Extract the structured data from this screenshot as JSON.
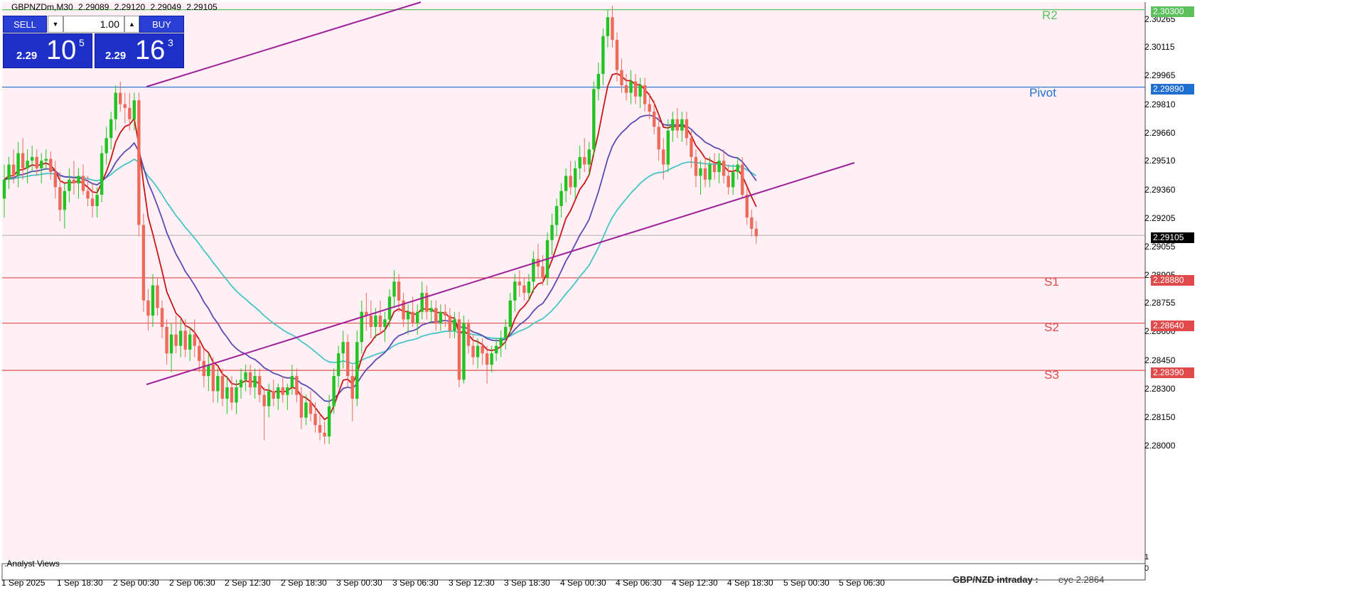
{
  "header": {
    "symbol": "GBPNZDm,M30",
    "ohlc": [
      "2.29089",
      "2.29120",
      "2.29049",
      "2.29105"
    ]
  },
  "trade_panel": {
    "sell_label": "SELL",
    "buy_label": "BUY",
    "lot": "1.00",
    "sell_price": {
      "small": "2.29",
      "big": "10",
      "sup": "5"
    },
    "buy_price": {
      "small": "2.29",
      "big": "16",
      "sup": "3"
    }
  },
  "price_axis": [
    "2.30265",
    "2.30115",
    "2.29965",
    "2.29810",
    "2.29660",
    "2.29510",
    "2.29360",
    "2.29205",
    "2.29055",
    "2.28905",
    "2.28755",
    "2.28600",
    "2.28450",
    "2.28300",
    "2.28150",
    "2.28000"
  ],
  "levels": [
    {
      "name": "R2",
      "value": "2.30300",
      "color": "#5cc05c"
    },
    {
      "name": "Pivot",
      "value": "2.29890",
      "color": "#1f6fd0"
    },
    {
      "name": "S1",
      "value": "2.28880",
      "color": "#e04a4a"
    },
    {
      "name": "S2",
      "value": "2.28640",
      "color": "#e04a4a"
    },
    {
      "name": "S3",
      "value": "2.28390",
      "color": "#e04a4a"
    }
  ],
  "current_price": "2.29105",
  "time_axis": [
    "1 Sep 2025",
    "1 Sep 18:30",
    "2 Sep 00:30",
    "2 Sep 06:30",
    "2 Sep 12:30",
    "2 Sep 18:30",
    "3 Sep 00:30",
    "3 Sep 06:30",
    "3 Sep 12:30",
    "3 Sep 18:30",
    "4 Sep 00:30",
    "4 Sep 06:30",
    "4 Sep 12:30",
    "4 Sep 18:30",
    "5 Sep 00:30",
    "5 Sep 06:30"
  ],
  "subwindow": {
    "label": ".Analyst Views",
    "axis_top": "1",
    "axis_bottom": "0"
  },
  "caption": {
    "title": "GBP/NZD intraday :",
    "value": "eye 2.2864"
  },
  "colors": {
    "background": "#fff0f5",
    "bull": "#22c322",
    "bear": "#ee6a5a",
    "ma_fast": "#c81414",
    "ma_mid": "#5a4ab4",
    "ma_slow": "#48c4c4",
    "trendline": "#a0209a"
  },
  "chart_data": {
    "type": "candlestick",
    "ylim": [
      2.2792,
      2.3034
    ],
    "series": [
      {
        "name": "GBPNZDm,M30",
        "values": [
          [
            2.293,
            2.2948,
            2.292,
            2.294
          ],
          [
            2.294,
            2.2952,
            2.2935,
            2.2948
          ],
          [
            2.2948,
            2.2956,
            2.2938,
            2.2942
          ],
          [
            2.2942,
            2.296,
            2.2936,
            2.2954
          ],
          [
            2.2954,
            2.2962,
            2.294,
            2.2946
          ],
          [
            2.2946,
            2.2956,
            2.2938,
            2.295
          ],
          [
            2.295,
            2.2958,
            2.2944,
            2.2952
          ],
          [
            2.2952,
            2.2956,
            2.2942,
            2.2946
          ],
          [
            2.2946,
            2.2954,
            2.2938,
            2.295
          ],
          [
            2.295,
            2.2956,
            2.2945,
            2.2951
          ],
          [
            2.2951,
            2.2955,
            2.294,
            2.2944
          ],
          [
            2.2944,
            2.295,
            2.293,
            2.2936
          ],
          [
            2.2936,
            2.2944,
            2.2918,
            2.2924
          ],
          [
            2.2924,
            2.2938,
            2.2914,
            2.2934
          ],
          [
            2.2934,
            2.2946,
            2.2928,
            2.294
          ],
          [
            2.294,
            2.295,
            2.2932,
            2.2938
          ],
          [
            2.2938,
            2.2946,
            2.293,
            2.2942
          ],
          [
            2.2942,
            2.2948,
            2.2932,
            2.2934
          ],
          [
            2.2934,
            2.2942,
            2.2926,
            2.293
          ],
          [
            2.293,
            2.2938,
            2.292,
            2.2926
          ],
          [
            2.2926,
            2.2936,
            2.292,
            2.2932
          ],
          [
            2.2932,
            2.2958,
            2.2928,
            2.2954
          ],
          [
            2.2954,
            2.2968,
            2.2948,
            2.2962
          ],
          [
            2.2962,
            2.2976,
            2.2956,
            2.2972
          ],
          [
            2.2972,
            2.299,
            2.2966,
            2.2986
          ],
          [
            2.2986,
            2.2992,
            2.2976,
            2.298
          ],
          [
            2.298,
            2.2986,
            2.297,
            2.2978
          ],
          [
            2.2978,
            2.2986,
            2.2966,
            2.2972
          ],
          [
            2.2972,
            2.2986,
            2.2966,
            2.2982
          ],
          [
            2.2982,
            2.2986,
            2.291,
            2.2916
          ],
          [
            2.2916,
            2.2922,
            2.287,
            2.2876
          ],
          [
            2.2876,
            2.2882,
            2.286,
            2.2868
          ],
          [
            2.2868,
            2.289,
            2.2862,
            2.2884
          ],
          [
            2.2884,
            2.2888,
            2.2868,
            2.2872
          ],
          [
            2.2872,
            2.2876,
            2.2856,
            2.2862
          ],
          [
            2.2862,
            2.2866,
            2.2842,
            2.2848
          ],
          [
            2.2848,
            2.2864,
            2.2838,
            2.2858
          ],
          [
            2.2858,
            2.2868,
            2.2848,
            2.2852
          ],
          [
            2.2852,
            2.2866,
            2.2846,
            2.286
          ],
          [
            2.286,
            2.2866,
            2.2846,
            2.285
          ],
          [
            2.285,
            2.2862,
            2.2844,
            2.2858
          ],
          [
            2.2858,
            2.2866,
            2.2846,
            2.2852
          ],
          [
            2.2852,
            2.2856,
            2.2838,
            2.2844
          ],
          [
            2.2844,
            2.285,
            2.283,
            2.2836
          ],
          [
            2.2836,
            2.2848,
            2.2828,
            2.2842
          ],
          [
            2.2842,
            2.2846,
            2.2822,
            2.2828
          ],
          [
            2.2828,
            2.284,
            2.2822,
            2.2836
          ],
          [
            2.2836,
            2.284,
            2.282,
            2.2824
          ],
          [
            2.2824,
            2.2836,
            2.2816,
            2.283
          ],
          [
            2.283,
            2.2836,
            2.2818,
            2.2822
          ],
          [
            2.2822,
            2.2834,
            2.2816,
            2.283
          ],
          [
            2.283,
            2.284,
            2.2824,
            2.2834
          ],
          [
            2.2834,
            2.2842,
            2.2828,
            2.2838
          ],
          [
            2.2838,
            2.2842,
            2.2826,
            2.283
          ],
          [
            2.283,
            2.284,
            2.2824,
            2.2836
          ],
          [
            2.2836,
            2.284,
            2.2822,
            2.2826
          ],
          [
            2.2826,
            2.283,
            2.2802,
            2.282
          ],
          [
            2.282,
            2.2832,
            2.2814,
            2.2828
          ],
          [
            2.2828,
            2.2834,
            2.282,
            2.2824
          ],
          [
            2.2824,
            2.2832,
            2.2818,
            2.283
          ],
          [
            2.283,
            2.2836,
            2.2822,
            2.2826
          ],
          [
            2.2826,
            2.2832,
            2.2818,
            2.283
          ],
          [
            2.283,
            2.2842,
            2.2826,
            2.2836
          ],
          [
            2.2836,
            2.284,
            2.2822,
            2.2826
          ],
          [
            2.2826,
            2.283,
            2.2808,
            2.2814
          ],
          [
            2.2814,
            2.2826,
            2.281,
            2.2822
          ],
          [
            2.2822,
            2.2828,
            2.2812,
            2.2816
          ],
          [
            2.2816,
            2.2822,
            2.2806,
            2.281
          ],
          [
            2.281,
            2.2816,
            2.2802,
            2.2806
          ],
          [
            2.2806,
            2.2812,
            2.28,
            2.2804
          ],
          [
            2.2804,
            2.2826,
            2.28,
            2.282
          ],
          [
            2.282,
            2.284,
            2.2816,
            2.2836
          ],
          [
            2.2836,
            2.2852,
            2.283,
            2.2848
          ],
          [
            2.2848,
            2.286,
            2.284,
            2.2854
          ],
          [
            2.2854,
            2.2858,
            2.283,
            2.2836
          ],
          [
            2.2836,
            2.2842,
            2.2812,
            2.2824
          ],
          [
            2.2824,
            2.286,
            2.282,
            2.2854
          ],
          [
            2.2854,
            2.2876,
            2.2848,
            2.287
          ],
          [
            2.287,
            2.288,
            2.286,
            2.2868
          ],
          [
            2.2868,
            2.2876,
            2.2856,
            2.2862
          ],
          [
            2.2862,
            2.2872,
            2.2856,
            2.2868
          ],
          [
            2.2868,
            2.2876,
            2.2858,
            2.2862
          ],
          [
            2.2862,
            2.287,
            2.2854,
            2.2866
          ],
          [
            2.2866,
            2.2882,
            2.2862,
            2.2878
          ],
          [
            2.2878,
            2.2892,
            2.2872,
            2.2886
          ],
          [
            2.2886,
            2.289,
            2.287,
            2.2876
          ],
          [
            2.2876,
            2.288,
            2.2862,
            2.2866
          ],
          [
            2.2866,
            2.2874,
            2.2858,
            2.287
          ],
          [
            2.287,
            2.2878,
            2.2862,
            2.2864
          ],
          [
            2.2864,
            2.2874,
            2.2858,
            2.287
          ],
          [
            2.287,
            2.2886,
            2.2866,
            2.288
          ],
          [
            2.288,
            2.2884,
            2.2866,
            2.287
          ],
          [
            2.287,
            2.2876,
            2.2864,
            2.2872
          ],
          [
            2.2872,
            2.2876,
            2.286,
            2.2864
          ],
          [
            2.2864,
            2.2874,
            2.286,
            2.287
          ],
          [
            2.287,
            2.2874,
            2.2862,
            2.2868
          ],
          [
            2.2868,
            2.2872,
            2.2856,
            2.286
          ],
          [
            2.286,
            2.287,
            2.2856,
            2.2866
          ],
          [
            2.2866,
            2.287,
            2.283,
            2.2834
          ],
          [
            2.2834,
            2.2868,
            2.2832,
            2.2864
          ],
          [
            2.2864,
            2.2866,
            2.2848,
            2.2852
          ],
          [
            2.2852,
            2.2858,
            2.2842,
            2.2846
          ],
          [
            2.2846,
            2.2856,
            2.284,
            2.2852
          ],
          [
            2.2852,
            2.2856,
            2.2842,
            2.2848
          ],
          [
            2.2848,
            2.2852,
            2.2832,
            2.2842
          ],
          [
            2.2842,
            2.2852,
            2.2838,
            2.2848
          ],
          [
            2.2848,
            2.2856,
            2.2844,
            2.2852
          ],
          [
            2.2852,
            2.286,
            2.2846,
            2.2856
          ],
          [
            2.2856,
            2.2866,
            2.285,
            2.2862
          ],
          [
            2.2862,
            2.288,
            2.2858,
            2.2876
          ],
          [
            2.2876,
            2.289,
            2.287,
            2.2886
          ],
          [
            2.2886,
            2.2892,
            2.2878,
            2.2884
          ],
          [
            2.2884,
            2.2888,
            2.2876,
            2.288
          ],
          [
            2.288,
            2.289,
            2.2876,
            2.2886
          ],
          [
            2.2886,
            2.2902,
            2.288,
            2.2898
          ],
          [
            2.2898,
            2.2906,
            2.2888,
            2.2894
          ],
          [
            2.2894,
            2.29,
            2.2884,
            2.2888
          ],
          [
            2.2888,
            2.2912,
            2.2884,
            2.2908
          ],
          [
            2.2908,
            2.2922,
            2.29,
            2.2916
          ],
          [
            2.2916,
            2.293,
            2.291,
            2.2926
          ],
          [
            2.2926,
            2.2938,
            2.292,
            2.2934
          ],
          [
            2.2934,
            2.2946,
            2.2928,
            2.2942
          ],
          [
            2.2942,
            2.295,
            2.2932,
            2.2936
          ],
          [
            2.2936,
            2.295,
            2.293,
            2.2946
          ],
          [
            2.2946,
            2.2958,
            2.294,
            2.2952
          ],
          [
            2.2952,
            2.2962,
            2.2944,
            2.2948
          ],
          [
            2.2948,
            2.296,
            2.2942,
            2.2956
          ],
          [
            2.2956,
            2.2992,
            2.2952,
            2.2988
          ],
          [
            2.2988,
            2.3002,
            2.2982,
            2.2996
          ],
          [
            2.2996,
            2.302,
            2.299,
            2.3016
          ],
          [
            2.3016,
            2.303,
            2.301,
            2.3026
          ],
          [
            2.3026,
            2.3032,
            2.301,
            2.3014
          ],
          [
            2.3014,
            2.3018,
            2.2992,
            2.2998
          ],
          [
            2.2998,
            2.3004,
            2.2986,
            2.299
          ],
          [
            2.299,
            2.2996,
            2.2982,
            2.2986
          ],
          [
            2.2986,
            2.2998,
            2.298,
            2.2992
          ],
          [
            2.2992,
            2.2996,
            2.298,
            2.2984
          ],
          [
            2.2984,
            2.2994,
            2.2978,
            2.299
          ],
          [
            2.299,
            2.2994,
            2.2976,
            2.298
          ],
          [
            2.298,
            2.2986,
            2.2972,
            2.2976
          ],
          [
            2.2976,
            2.2982,
            2.2964,
            2.2968
          ],
          [
            2.2968,
            2.2974,
            2.295,
            2.2956
          ],
          [
            2.2956,
            2.2962,
            2.294,
            2.2948
          ],
          [
            2.2948,
            2.2972,
            2.2944,
            2.2966
          ],
          [
            2.2966,
            2.2976,
            2.296,
            2.2972
          ],
          [
            2.2972,
            2.2978,
            2.2962,
            2.2966
          ],
          [
            2.2966,
            2.2976,
            2.296,
            2.2972
          ],
          [
            2.2972,
            2.2976,
            2.2958,
            2.2962
          ],
          [
            2.2962,
            2.2966,
            2.2946,
            2.2952
          ],
          [
            2.2952,
            2.2956,
            2.2936,
            2.2942
          ],
          [
            2.2942,
            2.295,
            2.2932,
            2.2946
          ],
          [
            2.2946,
            2.2952,
            2.2936,
            2.294
          ],
          [
            2.294,
            2.2952,
            2.2936,
            2.2948
          ],
          [
            2.2948,
            2.2954,
            2.294,
            2.2944
          ],
          [
            2.2944,
            2.2954,
            2.2938,
            2.295
          ],
          [
            2.295,
            2.2956,
            2.2938,
            2.2942
          ],
          [
            2.2942,
            2.2948,
            2.2932,
            2.2936
          ],
          [
            2.2936,
            2.2948,
            2.2932,
            2.2944
          ],
          [
            2.2944,
            2.2952,
            2.294,
            2.2948
          ],
          [
            2.2948,
            2.2952,
            2.293,
            2.2932
          ],
          [
            2.2932,
            2.2936,
            2.2916,
            2.292
          ],
          [
            2.292,
            2.2924,
            2.291,
            2.2914
          ],
          [
            2.2914,
            2.2918,
            2.2906,
            2.291
          ]
        ]
      }
    ]
  }
}
